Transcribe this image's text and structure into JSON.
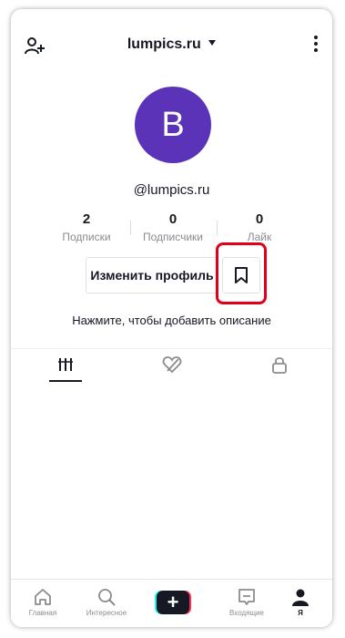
{
  "header": {
    "username": "lumpics.ru",
    "add_user_icon": "add-user-icon",
    "more_icon": "more-vertical-icon"
  },
  "profile": {
    "avatar_letter": "B",
    "avatar_color": "#5b33b8",
    "handle": "@lumpics.ru",
    "stats": [
      {
        "value": "2",
        "label": "Подписки"
      },
      {
        "value": "0",
        "label": "Подписчики"
      },
      {
        "value": "0",
        "label": "Лайк"
      }
    ],
    "edit_button": "Изменить профиль",
    "favorites_icon": "bookmark-icon",
    "bio_prompt": "Нажмите, чтобы добавить описание"
  },
  "tabs": [
    {
      "icon": "videos-grid-icon",
      "active": true
    },
    {
      "icon": "liked-hidden-icon",
      "active": false
    },
    {
      "icon": "lock-icon",
      "active": false
    }
  ],
  "highlight_color": "#e0001b",
  "bottom_nav": {
    "items": [
      {
        "label": "Главная",
        "icon": "home-icon"
      },
      {
        "label": "Интересное",
        "icon": "search-icon"
      },
      {
        "label": "",
        "icon": "create-plus-icon"
      },
      {
        "label": "Входящие",
        "icon": "inbox-icon"
      },
      {
        "label": "Я",
        "icon": "profile-icon",
        "active": true
      }
    ]
  }
}
